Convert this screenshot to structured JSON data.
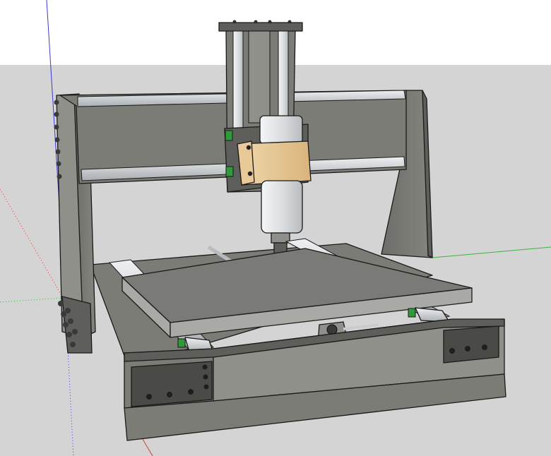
{
  "viewport": {
    "sky_color": "#ffffff",
    "ground_color": "#d4d4d4",
    "axis_colors": {
      "red": "#d23a3a",
      "green": "#3bb33b",
      "blue": "#3a3ad6"
    }
  },
  "model": {
    "concrete_color": "#7b7c76",
    "concrete_light": "#8f908a",
    "concrete_dark": "#5e5f5a",
    "table_color": "#7a7b77",
    "table_edge_color": "#a9aaa6",
    "rail_color": "#c7cbcf",
    "spindle_color": "#dfe2e3",
    "mount_color": "#e9c998",
    "bit_color": "#c6b24a",
    "accent_green": "#2f9a3a"
  }
}
